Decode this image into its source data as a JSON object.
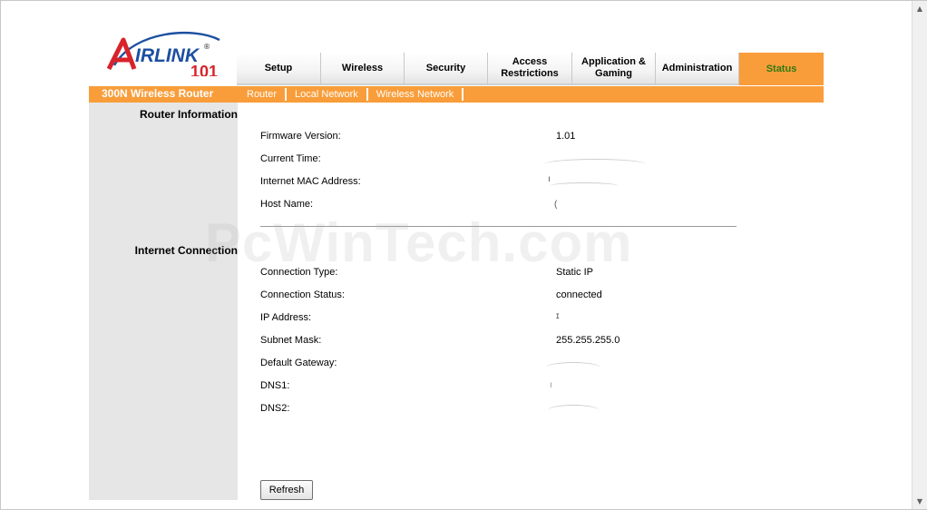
{
  "logo": {
    "brand_text": "AIRLINK",
    "model_text": "101",
    "registered": "®"
  },
  "nav": {
    "tabs": [
      {
        "label": "Setup",
        "active": false
      },
      {
        "label": "Wireless",
        "active": false
      },
      {
        "label": "Security",
        "active": false
      },
      {
        "label": "Access Restrictions",
        "active": false
      },
      {
        "label": "Application & Gaming",
        "active": false
      },
      {
        "label": "Administration",
        "active": false
      },
      {
        "label": "Status",
        "active": true
      }
    ]
  },
  "subbar": {
    "title": "300N Wireless Router",
    "subnav": [
      "Router",
      "Local Network",
      "Wireless Network"
    ]
  },
  "router_info": {
    "section_title": "Router Information",
    "firmware": {
      "label": "Firmware Version:",
      "value": "1.01"
    },
    "current_time": {
      "label": "Current Time:",
      "value": ""
    },
    "mac": {
      "label": "Internet MAC Address:",
      "value": ""
    },
    "host": {
      "label": "Host Name:",
      "value": ""
    }
  },
  "internet": {
    "section_title": "Internet Connection",
    "conn_type": {
      "label": "Connection Type:",
      "value": "Static IP"
    },
    "conn_status": {
      "label": "Connection Status:",
      "value": "connected"
    },
    "ip": {
      "label": "IP Address:",
      "value": ""
    },
    "subnet": {
      "label": "Subnet Mask:",
      "value": "255.255.255.0"
    },
    "gateway": {
      "label": "Default Gateway:",
      "value": ""
    },
    "dns1": {
      "label": "DNS1:",
      "value": ""
    },
    "dns2": {
      "label": "DNS2:",
      "value": ""
    }
  },
  "refresh_label": "Refresh",
  "watermark": "PcWinTech.com",
  "colors": {
    "accent": "#f99d3a",
    "active_tab_text": "#2f7a12",
    "logo_red": "#d8232a",
    "logo_blue": "#1c4fa0"
  }
}
